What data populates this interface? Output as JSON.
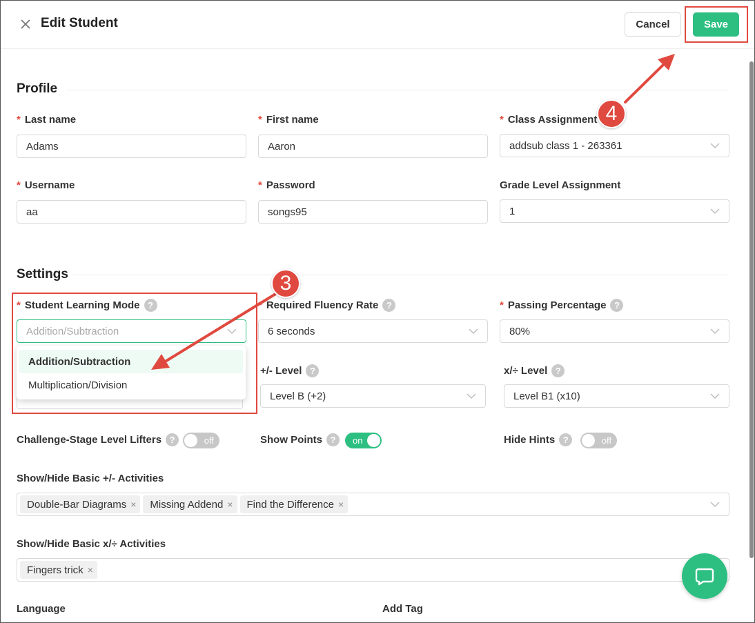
{
  "header": {
    "title": "Edit Student",
    "cancel_label": "Cancel",
    "save_label": "Save"
  },
  "profile": {
    "section_title": "Profile",
    "last_name": {
      "label": "Last name",
      "value": "Adams"
    },
    "first_name": {
      "label": "First name",
      "value": "Aaron"
    },
    "class_assignment": {
      "label": "Class Assignment",
      "value": "addsub class 1 - 263361"
    },
    "username": {
      "label": "Username",
      "value": "aa"
    },
    "password": {
      "label": "Password",
      "value": "songs95"
    },
    "grade_level": {
      "label": "Grade Level Assignment",
      "value": "1"
    }
  },
  "settings": {
    "section_title": "Settings",
    "learning_mode": {
      "label": "Student Learning Mode",
      "placeholder": "Addition/Subtraction",
      "options": [
        "Addition/Subtraction",
        "Multiplication/Division"
      ]
    },
    "fluency_rate": {
      "label": "Required Fluency Rate",
      "value": "6 seconds"
    },
    "passing_percentage": {
      "label": "Passing Percentage",
      "value": "80%"
    },
    "addsub_level": {
      "label": "+/- Level",
      "value": "Level B (+2)"
    },
    "muldiv_level": {
      "label": "x/÷ Level",
      "value": "Level B1 (x10)"
    },
    "challenge_lifters": {
      "label": "Challenge-Stage Level Lifters",
      "state": "off"
    },
    "show_points": {
      "label": "Show Points",
      "state": "on"
    },
    "hide_hints": {
      "label": "Hide Hints",
      "state": "off"
    },
    "basic_addsub": {
      "label": "Show/Hide Basic +/- Activities",
      "tags": [
        "Double-Bar Diagrams",
        "Missing Addend",
        "Find the Difference"
      ]
    },
    "basic_muldiv": {
      "label": "Show/Hide Basic x/÷ Activities",
      "tags": [
        "Fingers trick"
      ]
    },
    "language_label": "Language",
    "add_tag_label": "Add Tag",
    "help_glyph": "?",
    "required_glyph": "*",
    "remove_glyph": "×"
  },
  "annotations": {
    "step3": "3",
    "step4": "4",
    "color": "#e0493f"
  },
  "theme": {
    "accent": "#2dbf82"
  }
}
